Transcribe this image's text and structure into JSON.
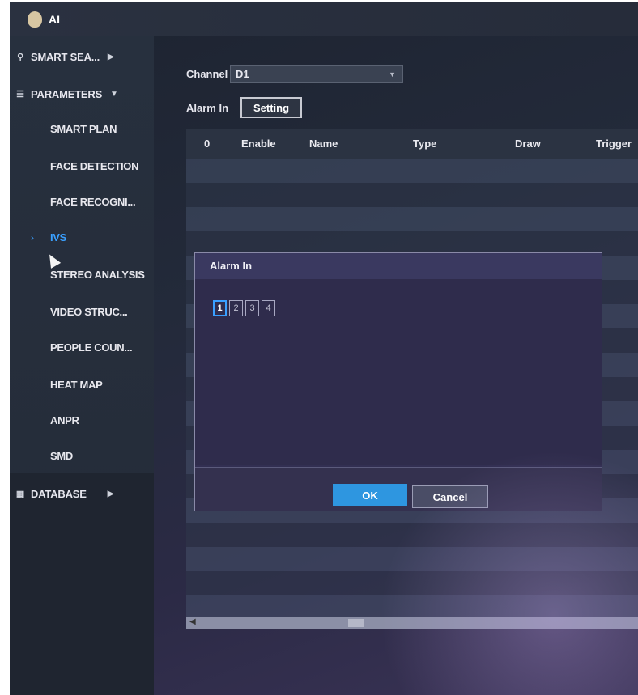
{
  "app": {
    "title": "AI"
  },
  "sidebar": {
    "smart_search": "SMART SEA...",
    "parameters": "PARAMETERS",
    "items": [
      {
        "label": "SMART PLAN"
      },
      {
        "label": "FACE DETECTION"
      },
      {
        "label": "FACE RECOGNI..."
      },
      {
        "label": "IVS",
        "active": true
      },
      {
        "label": "STEREO ANALYSIS"
      },
      {
        "label": "VIDEO STRUC..."
      },
      {
        "label": "PEOPLE COUN..."
      },
      {
        "label": "HEAT MAP"
      },
      {
        "label": "ANPR"
      },
      {
        "label": "SMD"
      }
    ],
    "database": "DATABASE"
  },
  "content": {
    "channel_label": "Channel",
    "channel_value": "D1",
    "alarm_in_label": "Alarm In",
    "setting_button": "Setting",
    "table": {
      "columns": [
        "0",
        "Enable",
        "Name",
        "Type",
        "Draw",
        "Trigger"
      ]
    }
  },
  "modal": {
    "title": "Alarm In",
    "options": [
      "1",
      "2",
      "3",
      "4"
    ],
    "selected": "1",
    "ok": "OK",
    "cancel": "Cancel"
  },
  "colors": {
    "accent": "#3aa0ff",
    "ok_button": "#2e96e0"
  }
}
